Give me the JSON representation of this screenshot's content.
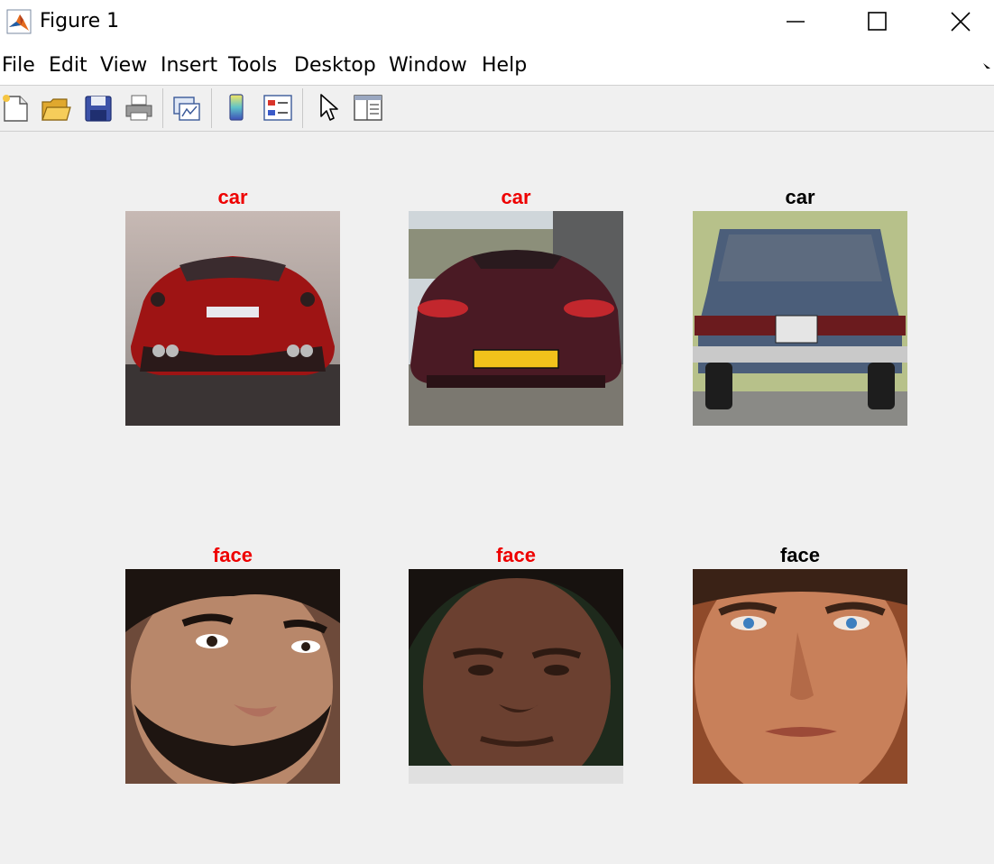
{
  "window": {
    "title": "Figure 1"
  },
  "menu": [
    "File",
    "Edit",
    "View",
    "Insert",
    "Tools",
    "Desktop",
    "Window",
    "Help"
  ],
  "toolbar": {
    "buttons": [
      "new-figure",
      "open-file",
      "save-figure",
      "print-figure",
      "link-plot",
      "insert-colorbar",
      "insert-legend",
      "edit-plot",
      "open-property-inspector"
    ]
  },
  "colors": {
    "misclassified": "#ee0000",
    "correct": "#000000"
  },
  "subplots": [
    {
      "title": "car",
      "title_color": "#ee0000",
      "image": "rear view of red sports car"
    },
    {
      "title": "car",
      "title_color": "#ee0000",
      "image": "rear view of maroon roadster"
    },
    {
      "title": "car",
      "title_color": "#000000",
      "image": "rear view of blue sedan"
    },
    {
      "title": "face",
      "title_color": "#ee0000",
      "image": "face of bearded man"
    },
    {
      "title": "face",
      "title_color": "#ee0000",
      "image": "face of older man"
    },
    {
      "title": "face",
      "title_color": "#000000",
      "image": "face of man with blue eyes"
    }
  ]
}
